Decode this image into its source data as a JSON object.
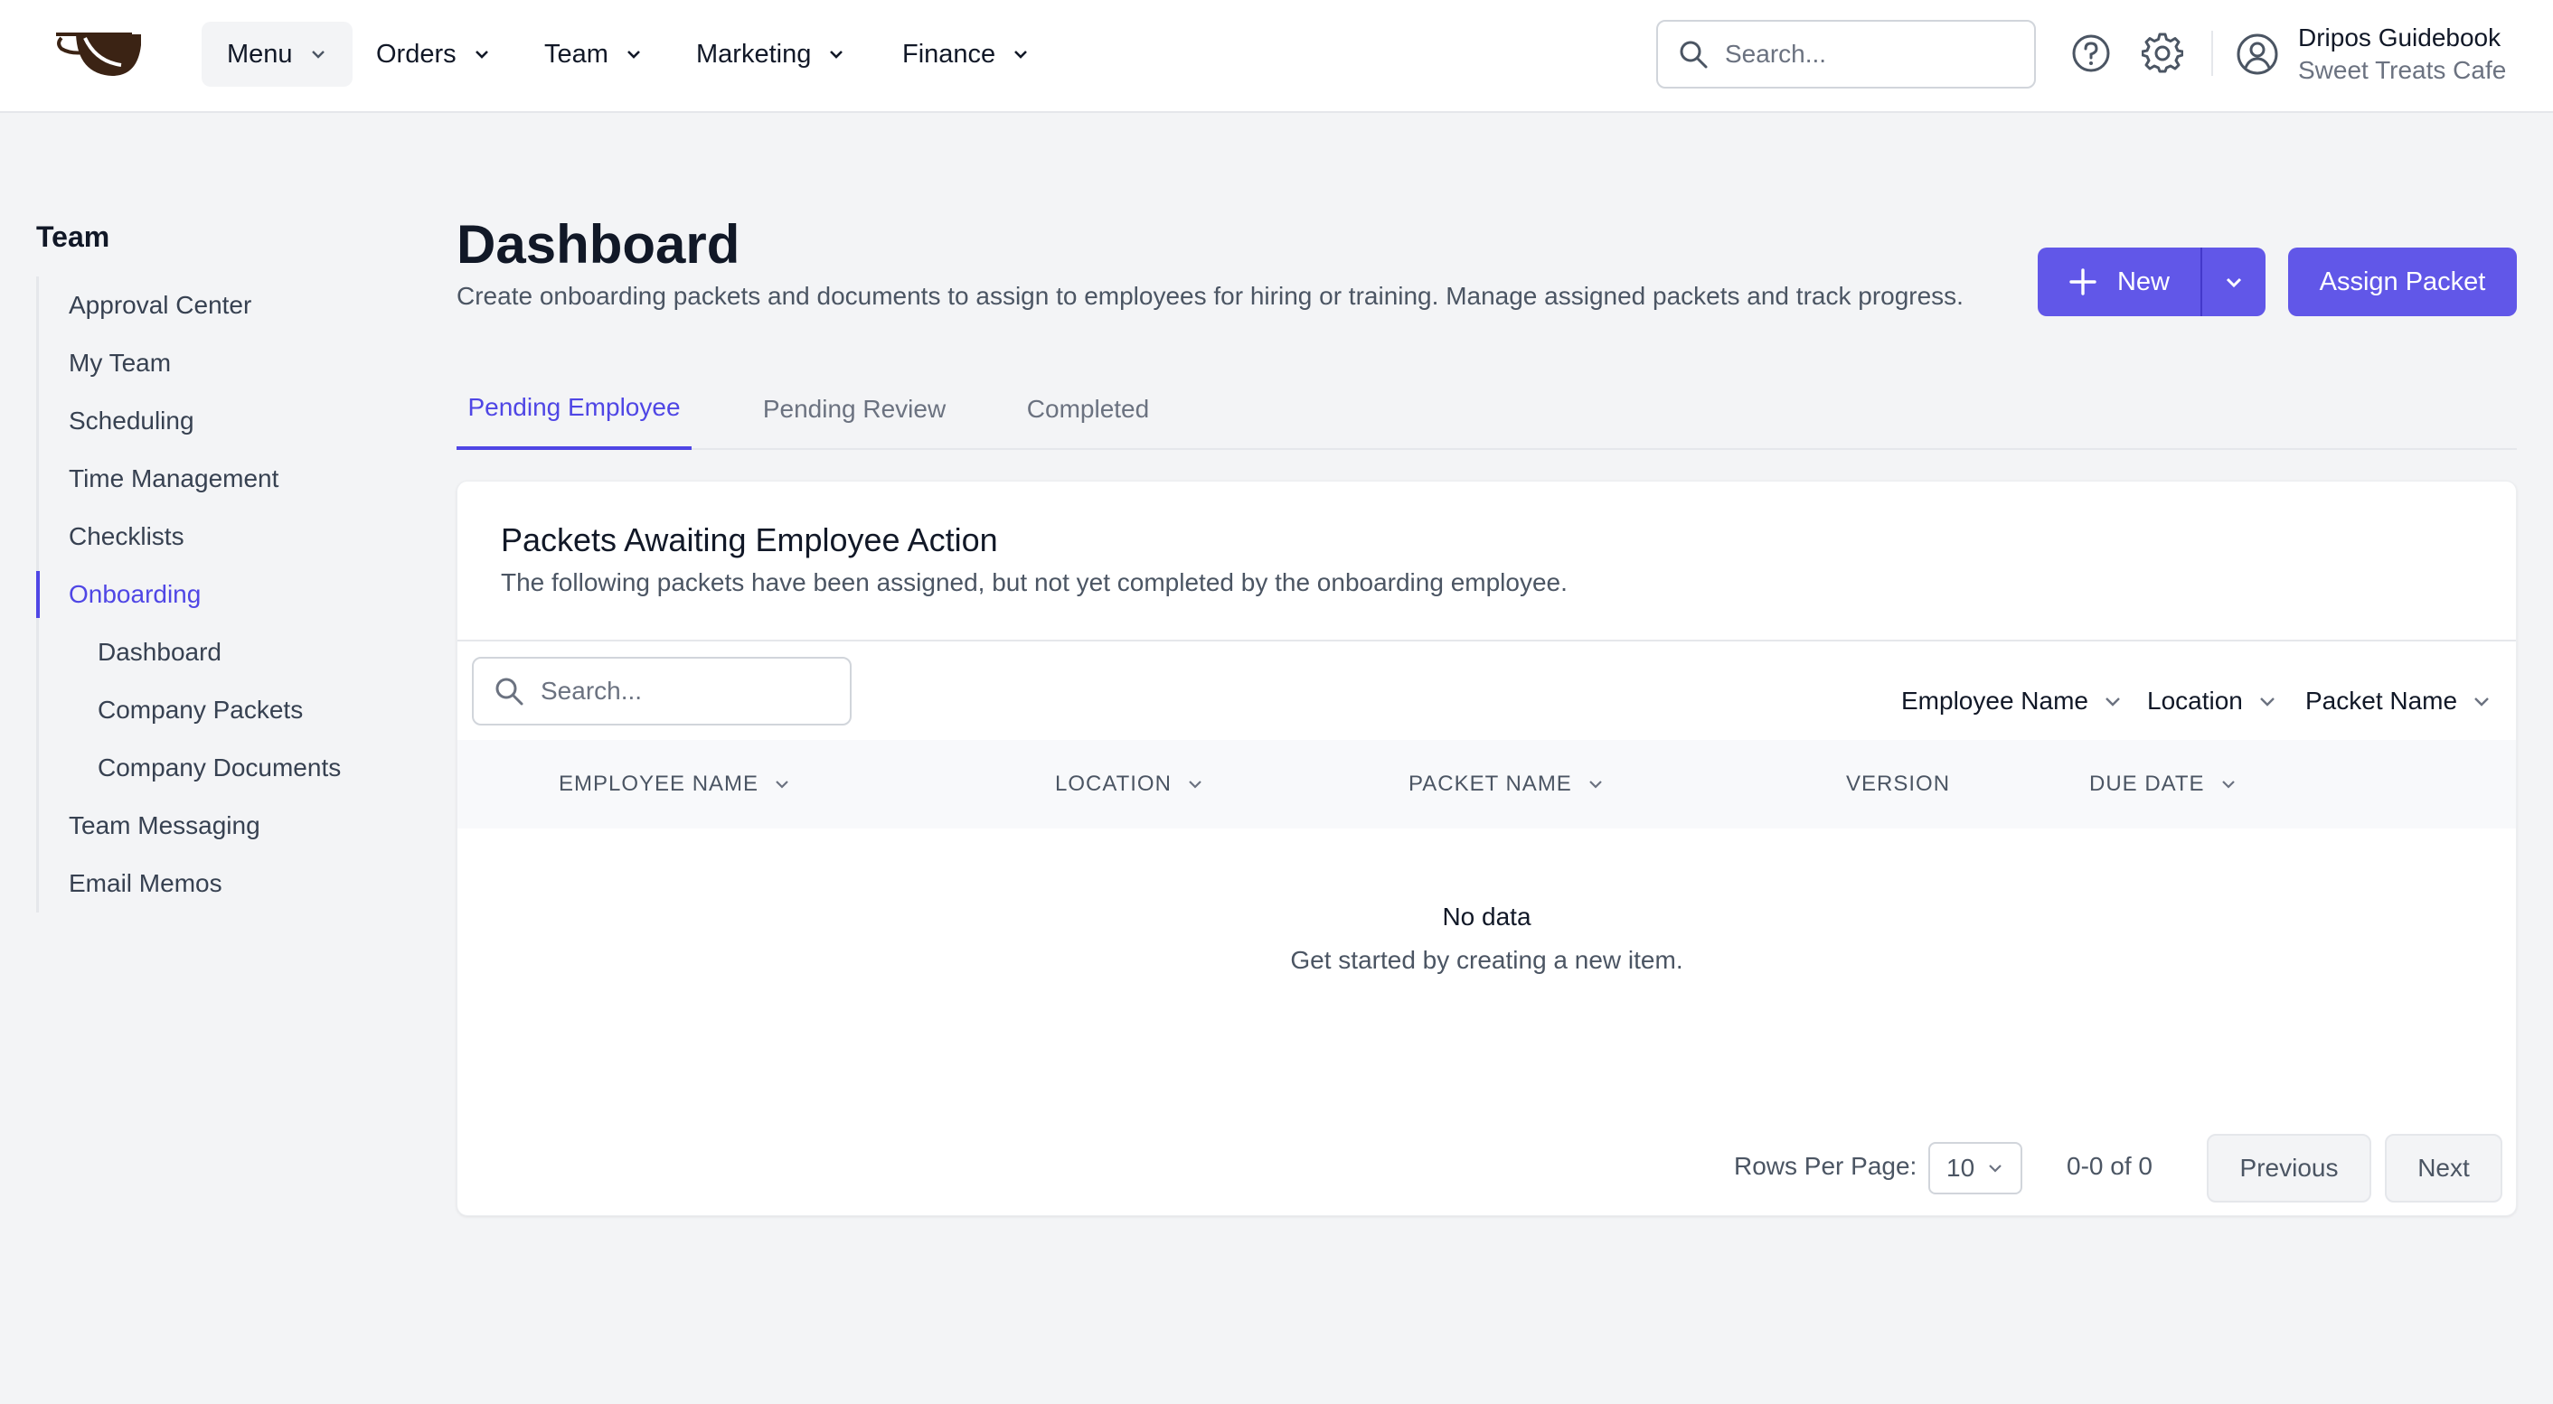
{
  "nav": {
    "items": [
      {
        "label": "Menu"
      },
      {
        "label": "Orders"
      },
      {
        "label": "Team"
      },
      {
        "label": "Marketing"
      },
      {
        "label": "Finance"
      }
    ],
    "search_placeholder": "Search...",
    "user": {
      "name": "Dripos Guidebook",
      "org": "Sweet Treats Cafe"
    }
  },
  "sidebar": {
    "title": "Team",
    "items": [
      {
        "label": "Approval Center"
      },
      {
        "label": "My Team"
      },
      {
        "label": "Scheduling"
      },
      {
        "label": "Time Management"
      },
      {
        "label": "Checklists"
      },
      {
        "label": "Onboarding"
      },
      {
        "label": "Dashboard"
      },
      {
        "label": "Company Packets"
      },
      {
        "label": "Company Documents"
      },
      {
        "label": "Team Messaging"
      },
      {
        "label": "Email Memos"
      }
    ]
  },
  "header": {
    "title": "Dashboard",
    "description": "Create onboarding packets and documents to assign to employees for hiring or training. Manage assigned packets and track progress.",
    "new_label": "New",
    "assign_label": "Assign Packet"
  },
  "tabs": [
    {
      "label": "Pending Employee"
    },
    {
      "label": "Pending Review"
    },
    {
      "label": "Completed"
    }
  ],
  "card": {
    "title": "Packets Awaiting Employee Action",
    "subtitle": "The following packets have been assigned, but not yet completed by the onboarding employee.",
    "search_placeholder": "Search...",
    "filters": [
      {
        "label": "Employee Name"
      },
      {
        "label": "Location"
      },
      {
        "label": "Packet Name"
      }
    ],
    "columns": [
      {
        "label": "EMPLOYEE NAME"
      },
      {
        "label": "LOCATION"
      },
      {
        "label": "PACKET NAME"
      },
      {
        "label": "VERSION"
      },
      {
        "label": "DUE DATE"
      }
    ],
    "empty_title": "No data",
    "empty_subtitle": "Get started by creating a new item.",
    "pagination": {
      "rows_label": "Rows Per Page:",
      "rows_value": "10",
      "range": "0-0 of 0",
      "previous": "Previous",
      "next": "Next"
    }
  },
  "colors": {
    "accent": "#4f46e5",
    "button": "#6157e8",
    "background": "#f3f4f6"
  }
}
